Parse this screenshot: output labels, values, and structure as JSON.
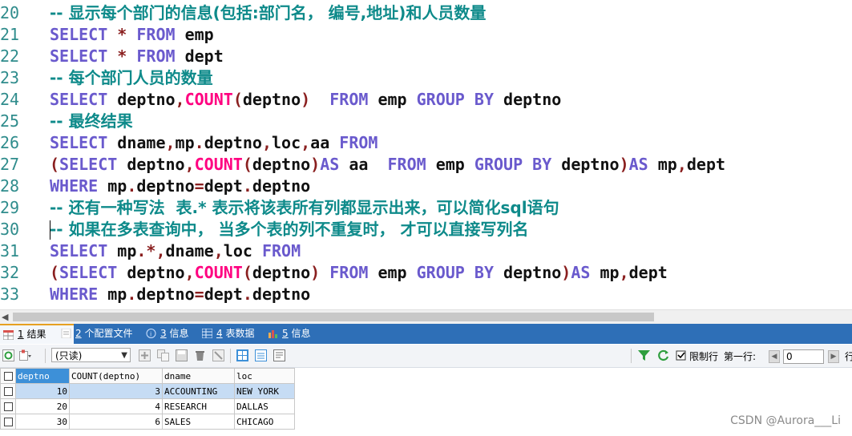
{
  "editor": {
    "lines": [
      {
        "no": "20",
        "tokens": [
          {
            "t": "cm",
            "v": "-- 显示每个部门的信息(包括:部门名， 编号,地址)和人员数量"
          }
        ]
      },
      {
        "no": "21",
        "tokens": [
          {
            "t": "kw",
            "v": "SELECT"
          },
          {
            "t": "id",
            "v": " "
          },
          {
            "t": "pn",
            "v": "*"
          },
          {
            "t": "id",
            "v": " "
          },
          {
            "t": "kw",
            "v": "FROM"
          },
          {
            "t": "id",
            "v": " emp"
          }
        ]
      },
      {
        "no": "22",
        "tokens": [
          {
            "t": "kw",
            "v": "SELECT"
          },
          {
            "t": "id",
            "v": " "
          },
          {
            "t": "pn",
            "v": "*"
          },
          {
            "t": "id",
            "v": " "
          },
          {
            "t": "kw",
            "v": "FROM"
          },
          {
            "t": "id",
            "v": " dept"
          }
        ]
      },
      {
        "no": "23",
        "tokens": [
          {
            "t": "cm",
            "v": "-- 每个部门人员的数量"
          }
        ]
      },
      {
        "no": "24",
        "tokens": [
          {
            "t": "kw",
            "v": "SELECT"
          },
          {
            "t": "id",
            "v": " deptno"
          },
          {
            "t": "pn",
            "v": ","
          },
          {
            "t": "fn",
            "v": "COUNT"
          },
          {
            "t": "pn",
            "v": "("
          },
          {
            "t": "id",
            "v": "deptno"
          },
          {
            "t": "pn",
            "v": ")"
          },
          {
            "t": "id",
            "v": "  "
          },
          {
            "t": "kw",
            "v": "FROM"
          },
          {
            "t": "id",
            "v": " emp "
          },
          {
            "t": "kw",
            "v": "GROUP"
          },
          {
            "t": "id",
            "v": " "
          },
          {
            "t": "kw",
            "v": "BY"
          },
          {
            "t": "id",
            "v": " deptno"
          }
        ]
      },
      {
        "no": "25",
        "tokens": [
          {
            "t": "cm",
            "v": "-- 最终结果"
          }
        ]
      },
      {
        "no": "26",
        "tokens": [
          {
            "t": "kw",
            "v": "SELECT"
          },
          {
            "t": "id",
            "v": " dname"
          },
          {
            "t": "pn",
            "v": ","
          },
          {
            "t": "id",
            "v": "mp"
          },
          {
            "t": "pn",
            "v": "."
          },
          {
            "t": "id",
            "v": "deptno"
          },
          {
            "t": "pn",
            "v": ","
          },
          {
            "t": "id",
            "v": "loc"
          },
          {
            "t": "pn",
            "v": ","
          },
          {
            "t": "id",
            "v": "aa "
          },
          {
            "t": "kw",
            "v": "FROM"
          }
        ]
      },
      {
        "no": "27",
        "tokens": [
          {
            "t": "pn",
            "v": "("
          },
          {
            "t": "kw",
            "v": "SELECT"
          },
          {
            "t": "id",
            "v": " deptno"
          },
          {
            "t": "pn",
            "v": ","
          },
          {
            "t": "fn",
            "v": "COUNT"
          },
          {
            "t": "pn",
            "v": "("
          },
          {
            "t": "id",
            "v": "deptno"
          },
          {
            "t": "pn",
            "v": ")"
          },
          {
            "t": "kw",
            "v": "AS"
          },
          {
            "t": "id",
            "v": " aa  "
          },
          {
            "t": "kw",
            "v": "FROM"
          },
          {
            "t": "id",
            "v": " emp "
          },
          {
            "t": "kw",
            "v": "GROUP"
          },
          {
            "t": "id",
            "v": " "
          },
          {
            "t": "kw",
            "v": "BY"
          },
          {
            "t": "id",
            "v": " deptno"
          },
          {
            "t": "pn",
            "v": ")"
          },
          {
            "t": "kw",
            "v": "AS"
          },
          {
            "t": "id",
            "v": " mp"
          },
          {
            "t": "pn",
            "v": ","
          },
          {
            "t": "id",
            "v": "dept"
          }
        ]
      },
      {
        "no": "28",
        "tokens": [
          {
            "t": "kw",
            "v": "WHERE"
          },
          {
            "t": "id",
            "v": " mp"
          },
          {
            "t": "pn",
            "v": "."
          },
          {
            "t": "id",
            "v": "deptno"
          },
          {
            "t": "pn",
            "v": "="
          },
          {
            "t": "id",
            "v": "dept"
          },
          {
            "t": "pn",
            "v": "."
          },
          {
            "t": "id",
            "v": "deptno"
          }
        ]
      },
      {
        "no": "29",
        "tokens": [
          {
            "t": "cm",
            "v": "-- 还有一种写法  表.* 表示将该表所有列都显示出来，可以简化sql语句"
          }
        ]
      },
      {
        "no": "30",
        "tokens": [
          {
            "t": "cm",
            "v": "-- 如果在多表查询中， 当多个表的列不重复时， 才可以直接写列名"
          }
        ]
      },
      {
        "no": "31",
        "tokens": [
          {
            "t": "kw",
            "v": "SELECT"
          },
          {
            "t": "id",
            "v": " mp"
          },
          {
            "t": "pn",
            "v": "."
          },
          {
            "t": "pn",
            "v": "*"
          },
          {
            "t": "pn",
            "v": ","
          },
          {
            "t": "id",
            "v": "dname"
          },
          {
            "t": "pn",
            "v": ","
          },
          {
            "t": "id",
            "v": "loc "
          },
          {
            "t": "kw",
            "v": "FROM"
          }
        ]
      },
      {
        "no": "32",
        "tokens": [
          {
            "t": "pn",
            "v": "("
          },
          {
            "t": "kw",
            "v": "SELECT"
          },
          {
            "t": "id",
            "v": " deptno"
          },
          {
            "t": "pn",
            "v": ","
          },
          {
            "t": "fn",
            "v": "COUNT"
          },
          {
            "t": "pn",
            "v": "("
          },
          {
            "t": "id",
            "v": "deptno"
          },
          {
            "t": "pn",
            "v": ")"
          },
          {
            "t": "id",
            "v": " "
          },
          {
            "t": "kw",
            "v": "FROM"
          },
          {
            "t": "id",
            "v": " emp "
          },
          {
            "t": "kw",
            "v": "GROUP"
          },
          {
            "t": "id",
            "v": " "
          },
          {
            "t": "kw",
            "v": "BY"
          },
          {
            "t": "id",
            "v": " deptno"
          },
          {
            "t": "pn",
            "v": ")"
          },
          {
            "t": "kw",
            "v": "AS"
          },
          {
            "t": "id",
            "v": " mp"
          },
          {
            "t": "pn",
            "v": ","
          },
          {
            "t": "id",
            "v": "dept"
          }
        ]
      },
      {
        "no": "33",
        "tokens": [
          {
            "t": "kw",
            "v": "WHERE"
          },
          {
            "t": "id",
            "v": " mp"
          },
          {
            "t": "pn",
            "v": "."
          },
          {
            "t": "id",
            "v": "deptno"
          },
          {
            "t": "pn",
            "v": "="
          },
          {
            "t": "id",
            "v": "dept"
          },
          {
            "t": "pn",
            "v": "."
          },
          {
            "t": "id",
            "v": "deptno"
          }
        ]
      }
    ]
  },
  "tabs": [
    {
      "num": "1",
      "label": " 结果",
      "icon": "result-grid-icon"
    },
    {
      "num": "2",
      "label": " 个配置文件",
      "icon": "profile-icon"
    },
    {
      "num": "3",
      "label": " 信息",
      "icon": "info-icon"
    },
    {
      "num": "4",
      "label": " 表数据",
      "icon": "table-data-icon"
    },
    {
      "num": "5",
      "label": " 信息",
      "icon": "info-chart-icon"
    }
  ],
  "toolbar": {
    "mode": "(只读)",
    "limit_label": "限制行",
    "first_row_label": "第一行:",
    "first_row_value": "0",
    "rows_label": "行"
  },
  "grid": {
    "columns": [
      "deptno",
      "COUNT(deptno)",
      "dname",
      "loc"
    ],
    "rows": [
      [
        "10",
        "3",
        "ACCOUNTING",
        "NEW YORK"
      ],
      [
        "20",
        "4",
        "RESEARCH",
        "DALLAS"
      ],
      [
        "30",
        "6",
        "SALES",
        "CHICAGO"
      ]
    ]
  },
  "watermark": "CSDN @Aurora___Li",
  "colors": {
    "keyword": "#6a5acd",
    "function": "#ff0080",
    "comment": "#0e8a8a",
    "line_number": "#2f8c8c",
    "tab_bar": "#2e6fb7",
    "selected_header": "#3d90d8",
    "selected_row": "#c6dcf4"
  }
}
